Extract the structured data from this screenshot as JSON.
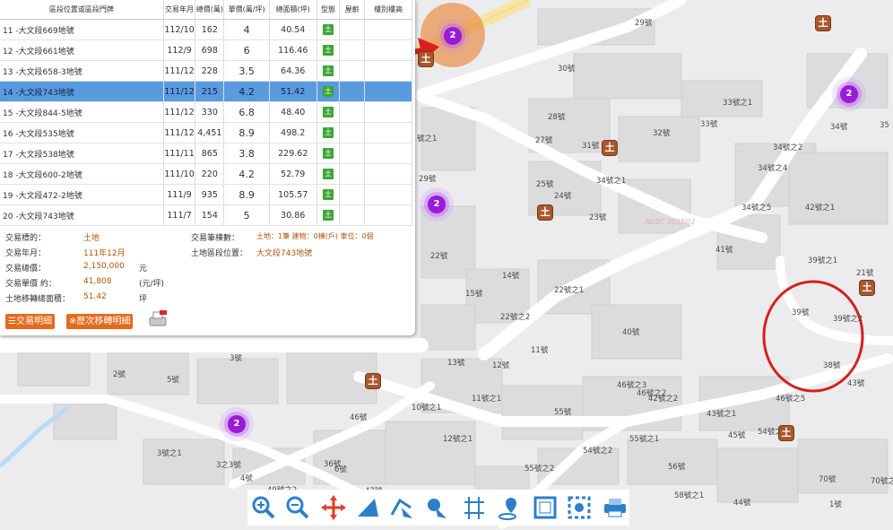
{
  "colors": {
    "map_bg": "#ececef",
    "selected_row": "#5a9be0",
    "land_tag": "#3aa635",
    "orange": "#e36b1d",
    "cluster": "#9b19d8",
    "parcel_icon": "#a8582c",
    "annotation_red": "#d81f1f"
  },
  "table": {
    "headers": [
      "區段位置或區段門牌",
      "交易年月",
      "總價(萬)",
      "單價(萬/坪)",
      "總面積(坪)",
      "型態",
      "屋齡",
      "樓別樓高"
    ],
    "rows": [
      {
        "address": "11 -大文段669地號",
        "date": "112/10",
        "total": "162",
        "unit": "4",
        "area": "40.54",
        "type": "土"
      },
      {
        "address": "12 -大文段661地號",
        "date": "112/9",
        "total": "698",
        "unit": "6",
        "area": "116.46",
        "type": "土"
      },
      {
        "address": "13 -大文段658-3地號",
        "date": "111/12",
        "total": "228",
        "unit": "3.5",
        "area": "64.36",
        "type": "土"
      },
      {
        "address": "14 -大文段743地號",
        "date": "111/12",
        "total": "215",
        "unit": "4.2",
        "area": "51.42",
        "type": "土"
      },
      {
        "address": "15 -大文段844-5地號",
        "date": "111/12",
        "total": "330",
        "unit": "6.8",
        "area": "48.40",
        "type": "土"
      },
      {
        "address": "16 -大文段535地號",
        "date": "111/12",
        "total": "4,451",
        "unit": "8.9",
        "area": "498.2",
        "type": "土"
      },
      {
        "address": "17 -大文段538地號",
        "date": "111/11",
        "total": "865",
        "unit": "3.8",
        "area": "229.62",
        "type": "土"
      },
      {
        "address": "18 -大文段600-2地號",
        "date": "111/10",
        "total": "220",
        "unit": "4.2",
        "area": "52.79",
        "type": "土"
      },
      {
        "address": "19 -大文段472-2地號",
        "date": "111/9",
        "total": "935",
        "unit": "8.9",
        "area": "105.57",
        "type": "土"
      },
      {
        "address": "20 -大文段743地號",
        "date": "111/7",
        "total": "154",
        "unit": "5",
        "area": "30.86",
        "type": "土"
      }
    ]
  },
  "details": {
    "target_label": "交易標的：",
    "target_value": "土地",
    "date_label": "交易年月：",
    "date_value": "111年12月",
    "total_label": "交易總價：",
    "total_value": "2,150,000",
    "total_unit": "元",
    "unit_label": "交易單價 約：",
    "unit_value": "41,808",
    "unit_unit": "(元/坪)",
    "area_label": "土地移轉總面積：",
    "area_value": "51.42",
    "area_unit": "坪",
    "count_label": "交易筆棟數：",
    "count_value": "土地：1筆 建物：0棟(戶) 車位：0個",
    "location_label": "土地區段位置：",
    "location_value": "大文段743地號"
  },
  "buttons": {
    "detail": "☰交易明細",
    "history": "※歷次移轉明細"
  },
  "map": {
    "watermark": "NLSC 2025Q2",
    "labels": [
      "29號",
      "30號",
      "28號",
      "27號",
      "31號",
      "33號之1",
      "34號",
      "35",
      "32號",
      "33號",
      "34號之2",
      "34號之4",
      "29號",
      "25號",
      "24號",
      "23號",
      "NLSC 2025Q2",
      "34號之1",
      "34號之5",
      "42號之1",
      "41號",
      "39號之1",
      "21號",
      "14號",
      "15號",
      "22號",
      "22號之1",
      "22號之2",
      "11號",
      "13號",
      "12號",
      "11號之1",
      "10號之1",
      "46號",
      "40號",
      "39號",
      "39號之2",
      "38號",
      "43號",
      "46號之5",
      "46號之3",
      "46號之2",
      "42號之2",
      "43號之1",
      "45號",
      "54號之1",
      "55號",
      "55號之1",
      "54號之2",
      "55號之2",
      "56號",
      "58號之1",
      "44號",
      "70號",
      "70號之2",
      "1號",
      "2號",
      "5號",
      "3號",
      "3號之1",
      "3之3號",
      "4號",
      "6號",
      "49號之2",
      "47號",
      "12號之1",
      "號之1",
      "36號"
    ],
    "clusters": [
      "2",
      "2",
      "2",
      "2"
    ]
  },
  "tools": [
    "zoom-in-icon",
    "zoom-out-icon",
    "pan-icon",
    "measure-area-icon",
    "measure-line-icon",
    "identify-icon",
    "road-icon",
    "location-icon",
    "select-box-icon",
    "clear-icon",
    "print-icon"
  ]
}
